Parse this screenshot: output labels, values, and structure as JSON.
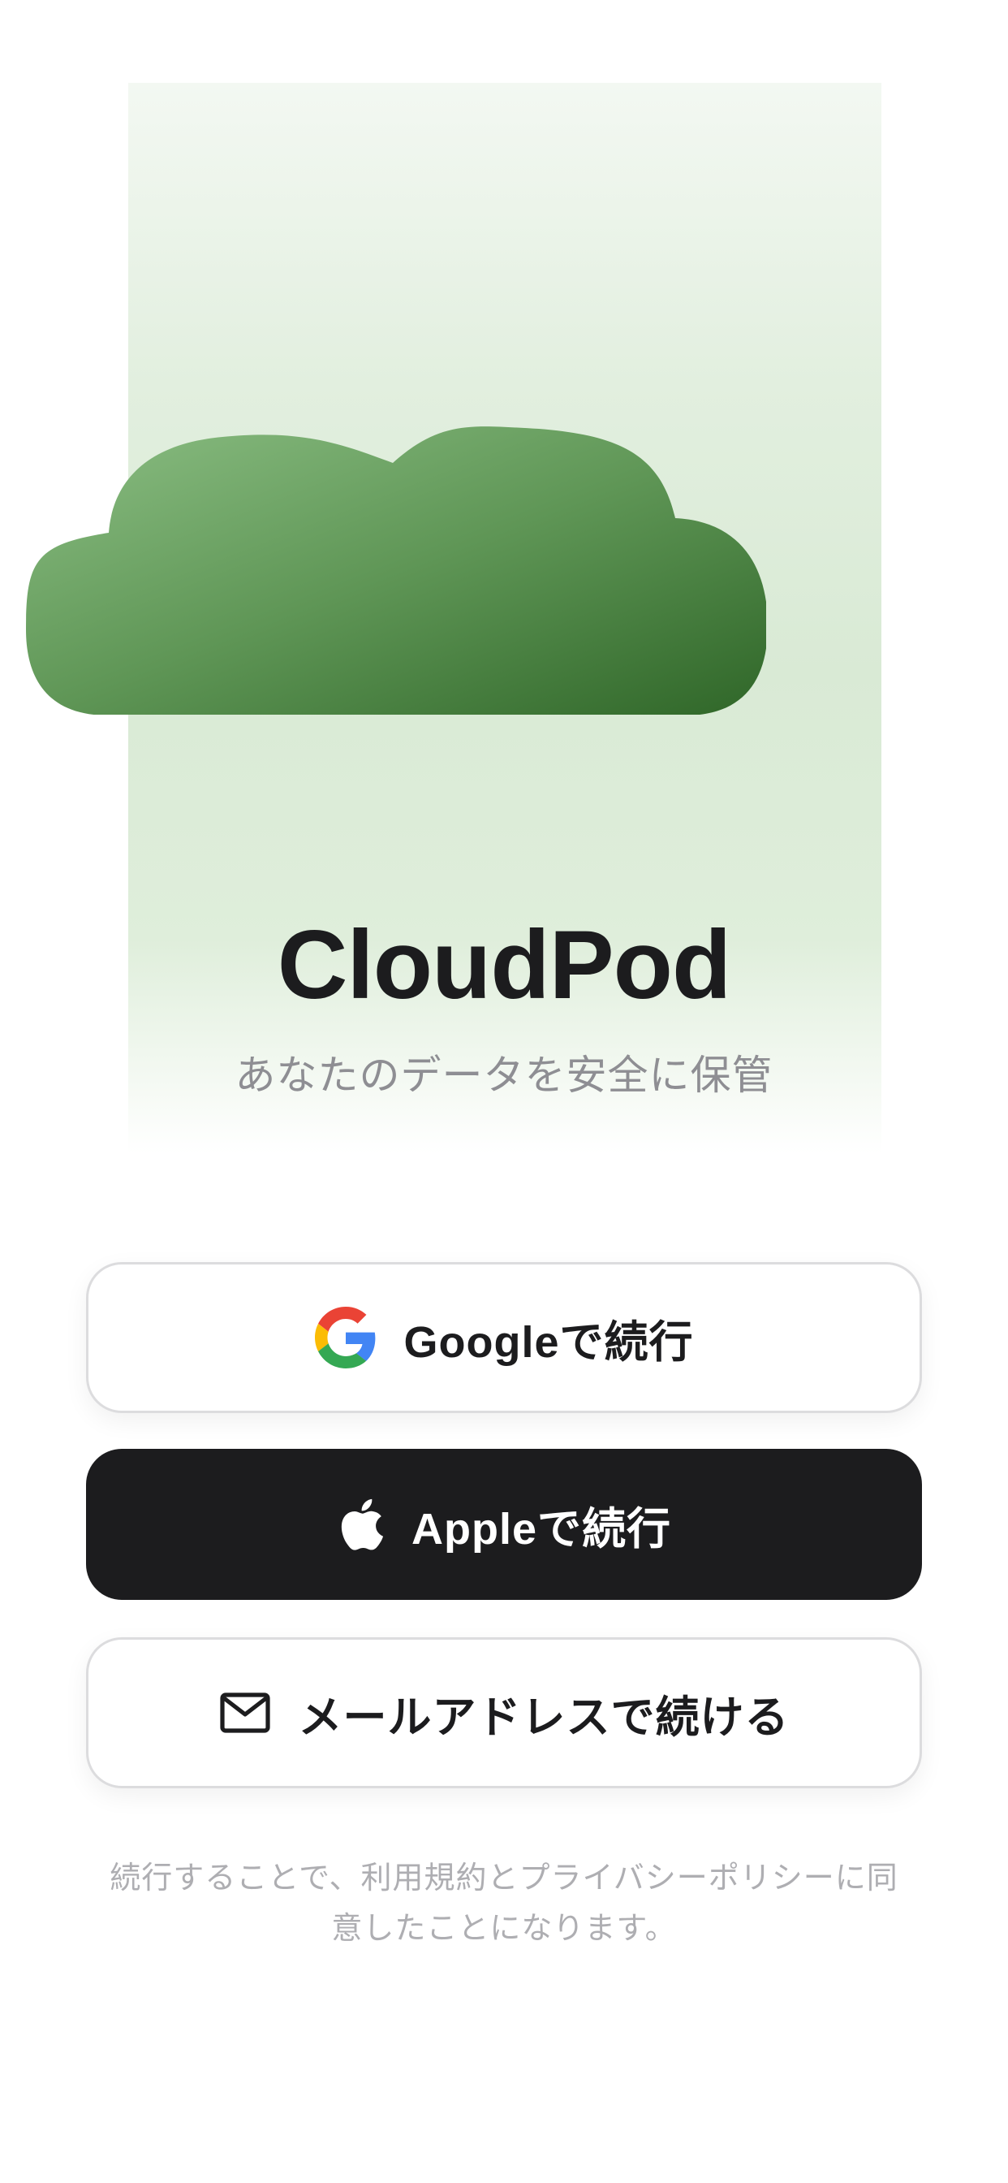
{
  "app": {
    "title": "CloudPod",
    "tagline": "あなたのデータを安全に保管"
  },
  "auth": {
    "google_label": "Googleで続行",
    "apple_label": "Appleで続行",
    "email_label": "メールアドレスで続ける"
  },
  "legal": {
    "text": "続行することで、利用規約とプライバシーポリシーに同意したことになります。"
  },
  "icons": {
    "hero": "cloud-illustration",
    "google": "google-g-icon",
    "apple": "apple-logo-icon",
    "email": "envelope-icon"
  },
  "colors": {
    "cloud_light": "#86b97e",
    "cloud_dark": "#336b2c",
    "dark_button": "#1c1c1e",
    "google_blue": "#4285F4",
    "google_red": "#EA4335",
    "google_yellow": "#FBBC05",
    "google_green": "#34A853"
  }
}
